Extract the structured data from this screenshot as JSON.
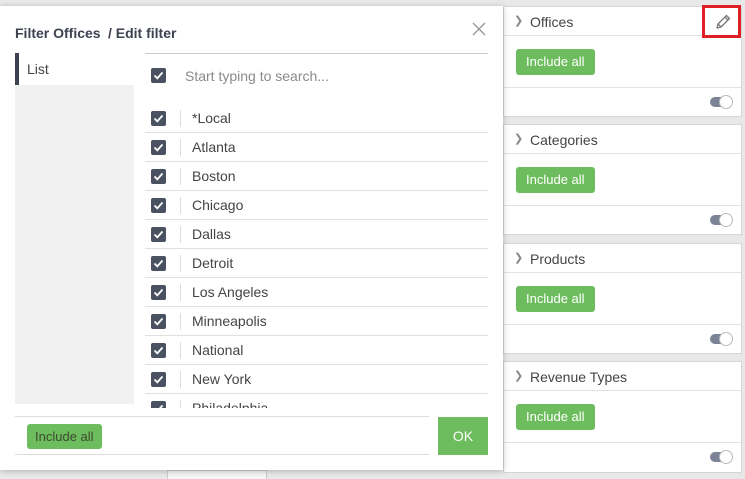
{
  "modal": {
    "title": "Filter Offices",
    "subtitle": "/ Edit filter",
    "nav": {
      "list_label": "List"
    },
    "search": {
      "placeholder": "Start typing to search..."
    },
    "items": [
      {
        "label": "*Local",
        "checked": true
      },
      {
        "label": "Atlanta",
        "checked": true
      },
      {
        "label": "Boston",
        "checked": true
      },
      {
        "label": "Chicago",
        "checked": true
      },
      {
        "label": "Dallas",
        "checked": true
      },
      {
        "label": "Detroit",
        "checked": true
      },
      {
        "label": "Los Angeles",
        "checked": true
      },
      {
        "label": "Minneapolis",
        "checked": true
      },
      {
        "label": "National",
        "checked": true
      },
      {
        "label": "New York",
        "checked": true
      },
      {
        "label": "Philadelphia",
        "checked": true
      }
    ],
    "include_all_label": "Include all",
    "ok_label": "OK"
  },
  "filters": [
    {
      "title": "Offices",
      "include_all_label": "Include all",
      "toggle_on": true
    },
    {
      "title": "Categories",
      "include_all_label": "Include all",
      "toggle_on": true
    },
    {
      "title": "Products",
      "include_all_label": "Include all",
      "toggle_on": true
    },
    {
      "title": "Revenue Types",
      "include_all_label": "Include all",
      "toggle_on": true
    }
  ],
  "colors": {
    "accent_green": "#6dbd5e",
    "checkbox": "#4a5160",
    "highlight": "#e01e26"
  },
  "icons": {
    "edit": "pencil-icon",
    "close": "close-icon",
    "expand": "chevron-right-icon"
  }
}
